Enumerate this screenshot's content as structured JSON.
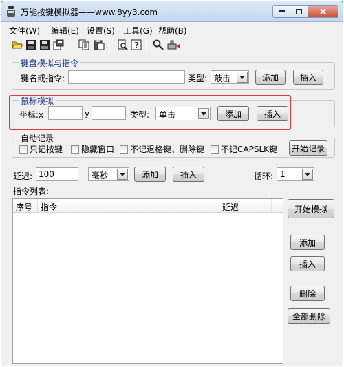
{
  "window": {
    "title": "万能按键模拟器——www.8yy3.com",
    "controls": {
      "minimize": "minimize",
      "maximize": "maximize",
      "close": "close"
    }
  },
  "menu": [
    {
      "label": "文件(W)"
    },
    {
      "label": "编辑(E)"
    },
    {
      "label": "设置(S)"
    },
    {
      "label": "工具(G)"
    },
    {
      "label": "帮助(B)"
    }
  ],
  "toolbar": {
    "icons": [
      "open-folder-icon",
      "save-icon",
      "save-as-icon",
      "properties-icon",
      "copy-icon",
      "paste-icon",
      "print-preview-icon",
      "help-icon",
      "search-icon",
      "record-icon"
    ]
  },
  "keyboard_group": {
    "title": "键盘模拟与指令",
    "key_label": "键名或指令:",
    "key_value": "",
    "type_label": "类型:",
    "type_value": "敲击",
    "add_label": "添加",
    "insert_label": "插入"
  },
  "mouse_group": {
    "title": "鼠标模拟",
    "coord_label": "坐标:x",
    "x_value": "",
    "y_label": "y",
    "y_value": "",
    "type_label": "类型:",
    "type_value": "单击",
    "add_label": "添加",
    "insert_label": "插入"
  },
  "auto_record": {
    "title": "自动记录",
    "options": [
      {
        "label": "只记按键"
      },
      {
        "label": "隐藏窗口"
      },
      {
        "label": "不记退格键、删除键"
      },
      {
        "label": "不记CAPSLK键"
      }
    ],
    "start_label": "开始记录"
  },
  "delay": {
    "label": "延迟:",
    "value": "100",
    "unit": "毫秒",
    "add_label": "添加",
    "insert_label": "插入",
    "loop_label": "循环:",
    "loop_value": "1"
  },
  "command_list": {
    "title": "指令列表:",
    "columns": [
      "序号",
      "指令",
      "延迟"
    ]
  },
  "side_buttons": {
    "start_sim": "开始模拟",
    "add": "添加",
    "insert": "插入",
    "delete": "删除",
    "delete_all": "全部删除"
  },
  "colors": {
    "highlight": "#e03c3c",
    "group_title": "#1e3a8a"
  }
}
